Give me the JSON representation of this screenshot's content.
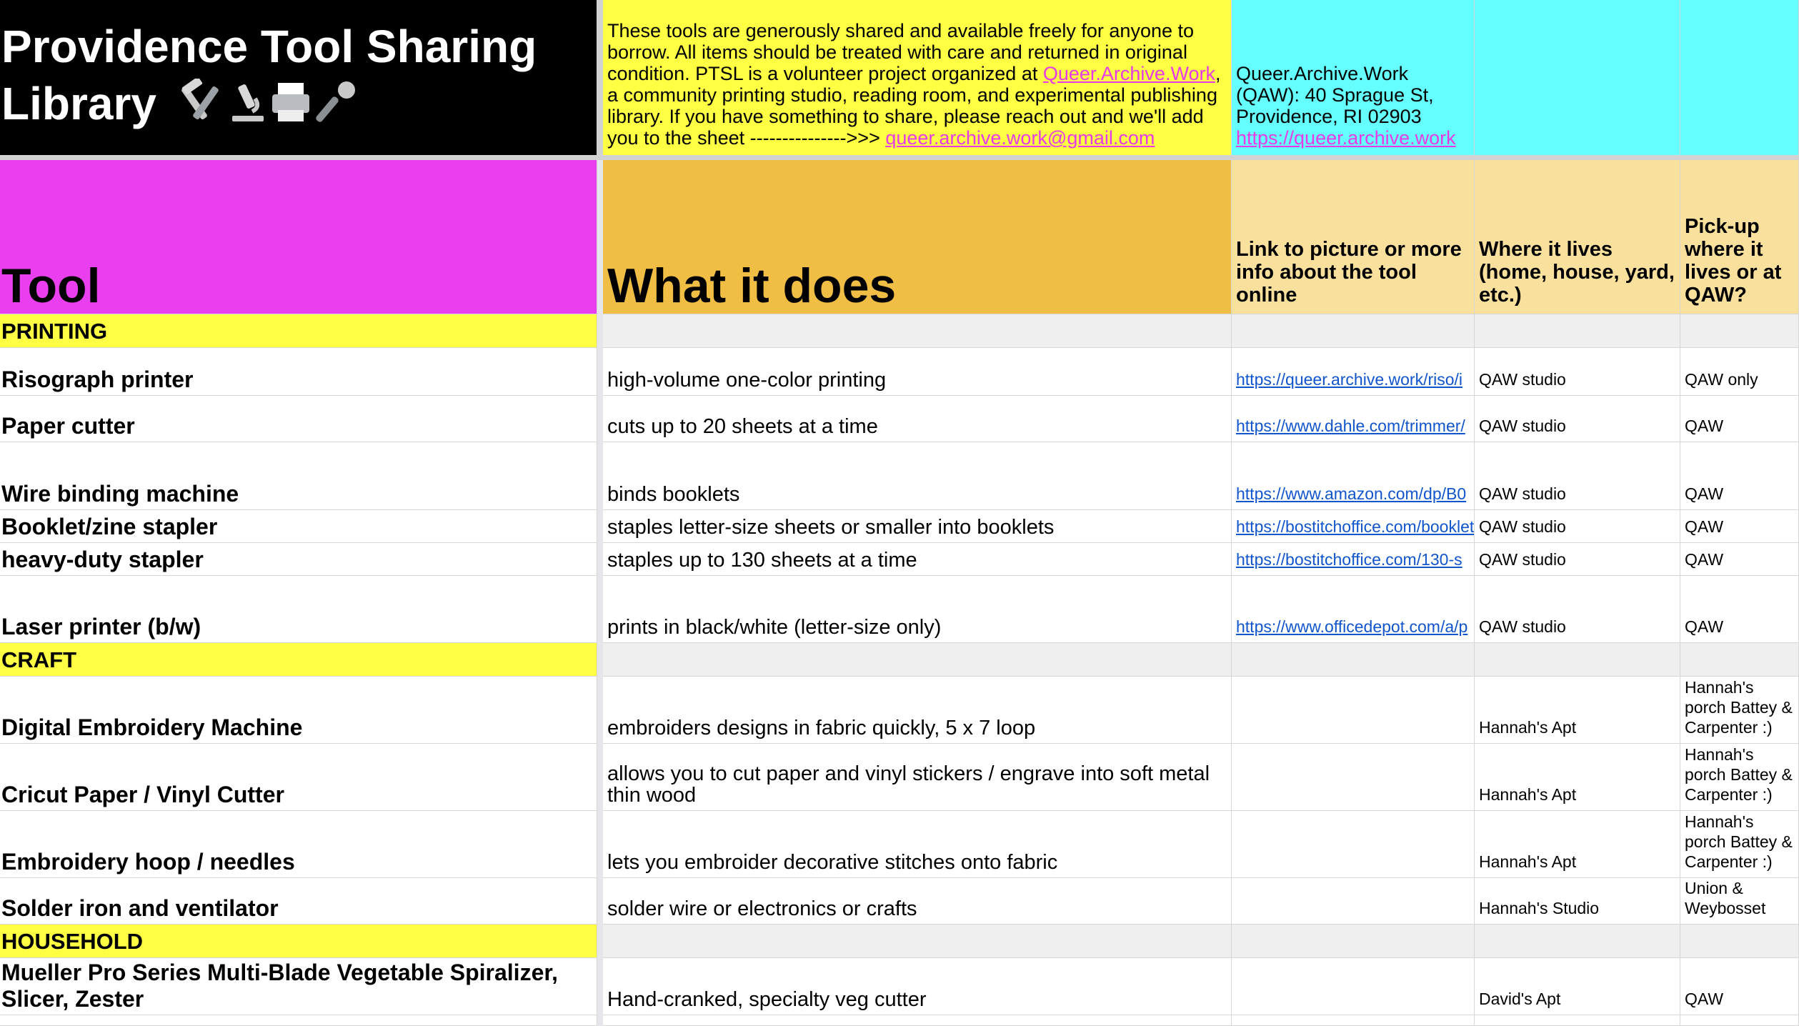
{
  "banner": {
    "title_line1": "Providence Tool Sharing",
    "title_line2": "Library",
    "title_emoji": [
      "hammer-and-wrench",
      "microscope",
      "printer",
      "microphone"
    ],
    "intro_text": "These tools are generously shared and available freely for anyone to borrow. All items should be treated with care and returned in original condition. PTSL is a volunteer project organized at ",
    "intro_link": "Queer.Archive.Work",
    "intro_text2": ", a community printing studio, reading room, and experimental publishing library. If you have something to share, please reach out and we'll add you to the sheet --------------->>> ",
    "intro_email": "queer.archive.work@gmail.com",
    "address_text": "Queer.Archive.Work (QAW): 40 Sprague St, Providence, RI 02903",
    "address_link": "https://queer.archive.work"
  },
  "headers": {
    "tool": "Tool",
    "what": "What it does",
    "link": "Link to picture or more info about the tool online",
    "lives": "Where it lives (home, house, yard, etc.)",
    "pickup": "Pick-up where it lives or at QAW?"
  },
  "sections": [
    {
      "name": "PRINTING",
      "rows": [
        {
          "tool": "Risograph printer",
          "what": "high-volume one-color printing",
          "link": "https://queer.archive.work/riso/i",
          "lives": "QAW studio",
          "pickup": "QAW only"
        },
        {
          "tool": "Paper cutter",
          "what": "cuts up to 20 sheets at a time",
          "link": "https://www.dahle.com/trimmer/",
          "lives": "QAW studio",
          "pickup": "QAW"
        },
        {
          "tool": "Wire binding machine",
          "what": "binds booklets",
          "link": "https://www.amazon.com/dp/B0",
          "lives": "QAW studio",
          "pickup": "QAW"
        },
        {
          "tool": "Booklet/zine stapler",
          "what": "staples letter-size sheets or smaller into booklets",
          "link": "https://bostitchoffice.com/booklet",
          "lives": "QAW studio",
          "pickup": "QAW"
        },
        {
          "tool": "heavy-duty stapler",
          "what": "staples up to 130 sheets at a time",
          "link": "https://bostitchoffice.com/130-s",
          "lives": "QAW studio",
          "pickup": "QAW"
        },
        {
          "tool": "Laser printer (b/w)",
          "what": "prints in black/white (letter-size only)",
          "link": "https://www.officedepot.com/a/p",
          "lives": "QAW studio",
          "pickup": "QAW"
        }
      ]
    },
    {
      "name": "CRAFT",
      "rows": [
        {
          "tool": "Digital Embroidery Machine",
          "what": "embroiders designs in fabric quickly, 5 x 7 loop",
          "link": "",
          "lives": "Hannah's Apt",
          "pickup": "Hannah's porch Battey & Carpenter :)"
        },
        {
          "tool": "Cricut Paper / Vinyl Cutter",
          "what": "allows you to cut paper and vinyl stickers / engrave into soft metal thin wood",
          "link": "",
          "lives": "Hannah's Apt",
          "pickup": "Hannah's porch Battey & Carpenter :)"
        },
        {
          "tool": "Embroidery hoop / needles",
          "what": "lets you embroider decorative stitches onto fabric",
          "link": "",
          "lives": "Hannah's Apt",
          "pickup": "Hannah's porch Battey & Carpenter :)"
        },
        {
          "tool": "Solder iron and ventilator",
          "what": "solder wire or electronics or crafts",
          "link": "",
          "lives": "Hannah's Studio",
          "pickup": "Union & Weybosset"
        }
      ]
    },
    {
      "name": "HOUSEHOLD",
      "rows": [
        {
          "tool": "Mueller Pro Series Multi-Blade Vegetable Spiralizer, Slicer, Zester",
          "what": "Hand-cranked, specialty veg cutter",
          "link": "",
          "lives": "David's Apt",
          "pickup": "QAW"
        }
      ]
    }
  ]
}
